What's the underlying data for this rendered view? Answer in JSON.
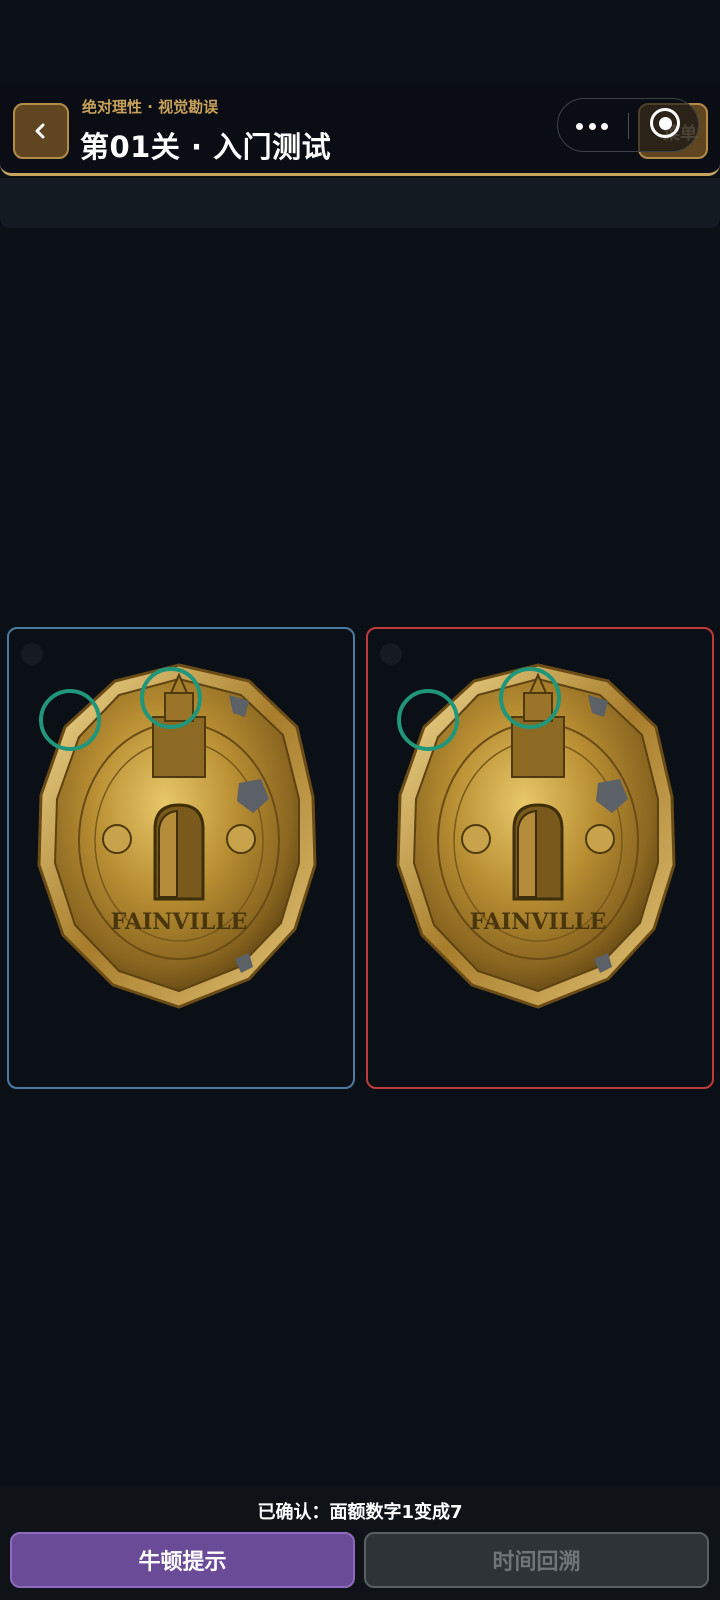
{
  "header": {
    "subtitle": "绝对理性 · 视觉勘误",
    "title": "第01关 · 入门测试",
    "menu_label": "菜单"
  },
  "icons": {
    "back": "chevron-left-icon",
    "more": "more-dots-icon",
    "record": "record-icon"
  },
  "panels": {
    "left": {
      "border_color": "#4c7ba2",
      "coin_text": "FAINVILLE"
    },
    "right": {
      "border_color": "#c03a3a",
      "coin_text": "FAINVILLE"
    },
    "found_markers": 2,
    "marker_color": "#20967a"
  },
  "status": {
    "confirmed": "已确认：面额数字1变成7"
  },
  "buttons": {
    "hint": "牛顿提示",
    "rewind": "时间回溯"
  },
  "colors": {
    "background": "#0b0f16",
    "gold_accent": "#c9a25a",
    "hint_purple": "#6a4b98"
  }
}
